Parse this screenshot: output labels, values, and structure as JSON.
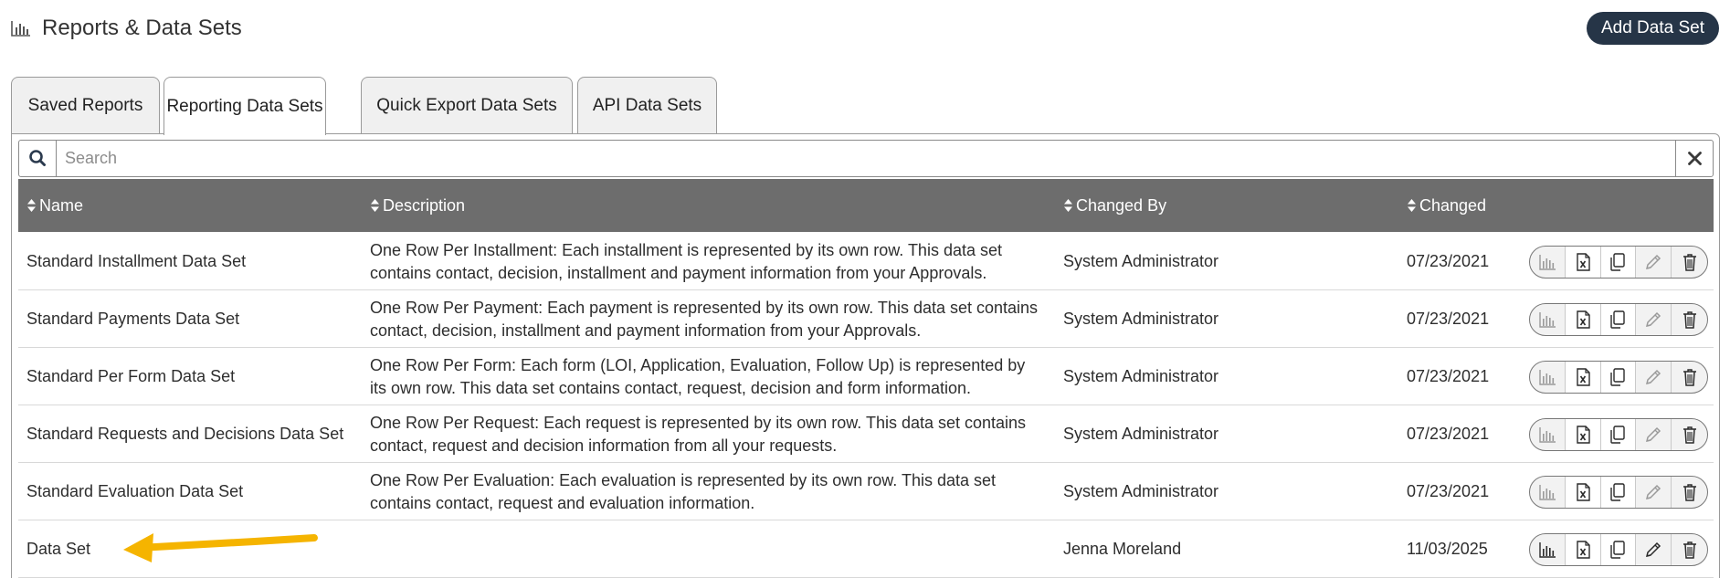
{
  "header": {
    "title": "Reports & Data Sets",
    "icon": "bar-chart-icon",
    "add_button": "Add Data Set"
  },
  "tabs": [
    {
      "label": "Saved Reports",
      "active": false
    },
    {
      "label": "Reporting Data Sets",
      "active": true
    },
    {
      "label": "Quick Export Data Sets",
      "active": false
    },
    {
      "label": "API Data Sets",
      "active": false
    }
  ],
  "search": {
    "placeholder": "Search",
    "value": "",
    "search_icon": "magnifier-icon",
    "clear_icon": "close-icon"
  },
  "table": {
    "columns": [
      "Name",
      "Description",
      "Changed By",
      "Changed"
    ],
    "rows": [
      {
        "name": "Standard Installment Data Set",
        "description": "One Row Per Installment: Each installment is represented by its own row. This data set contains contact, decision, installment and payment information from your Approvals.",
        "changed_by": "System Administrator",
        "changed": "07/23/2021"
      },
      {
        "name": "Standard Payments Data Set",
        "description": "One Row Per Payment: Each payment is represented by its own row. This data set contains contact, decision, installment and payment information from your Approvals.",
        "changed_by": "System Administrator",
        "changed": "07/23/2021"
      },
      {
        "name": "Standard Per Form Data Set",
        "description": "One Row Per Form: Each form (LOI, Application, Evaluation, Follow Up) is represented by its own row. This data set contains contact, request, decision and form information.",
        "changed_by": "System Administrator",
        "changed": "07/23/2021"
      },
      {
        "name": "Standard Requests and Decisions Data Set",
        "description": "One Row Per Request: Each request is represented by its own row. This data set contains contact, request and decision information from all your requests.",
        "changed_by": "System Administrator",
        "changed": "07/23/2021"
      },
      {
        "name": "Standard Evaluation Data Set",
        "description": "One Row Per Evaluation: Each evaluation is represented by its own row. This data set contains contact, request and evaluation information.",
        "changed_by": "System Administrator",
        "changed": "07/23/2021"
      },
      {
        "name": "Data Set",
        "description": "",
        "changed_by": "Jenna Moreland",
        "changed": "11/03/2025"
      }
    ],
    "row_actions": [
      "chart-icon",
      "excel-icon",
      "copy-icon",
      "edit-icon",
      "delete-icon"
    ]
  },
  "colors": {
    "header_bg": "#6d6d6d",
    "add_button_bg": "#263547",
    "arrow": "#f5b400"
  }
}
